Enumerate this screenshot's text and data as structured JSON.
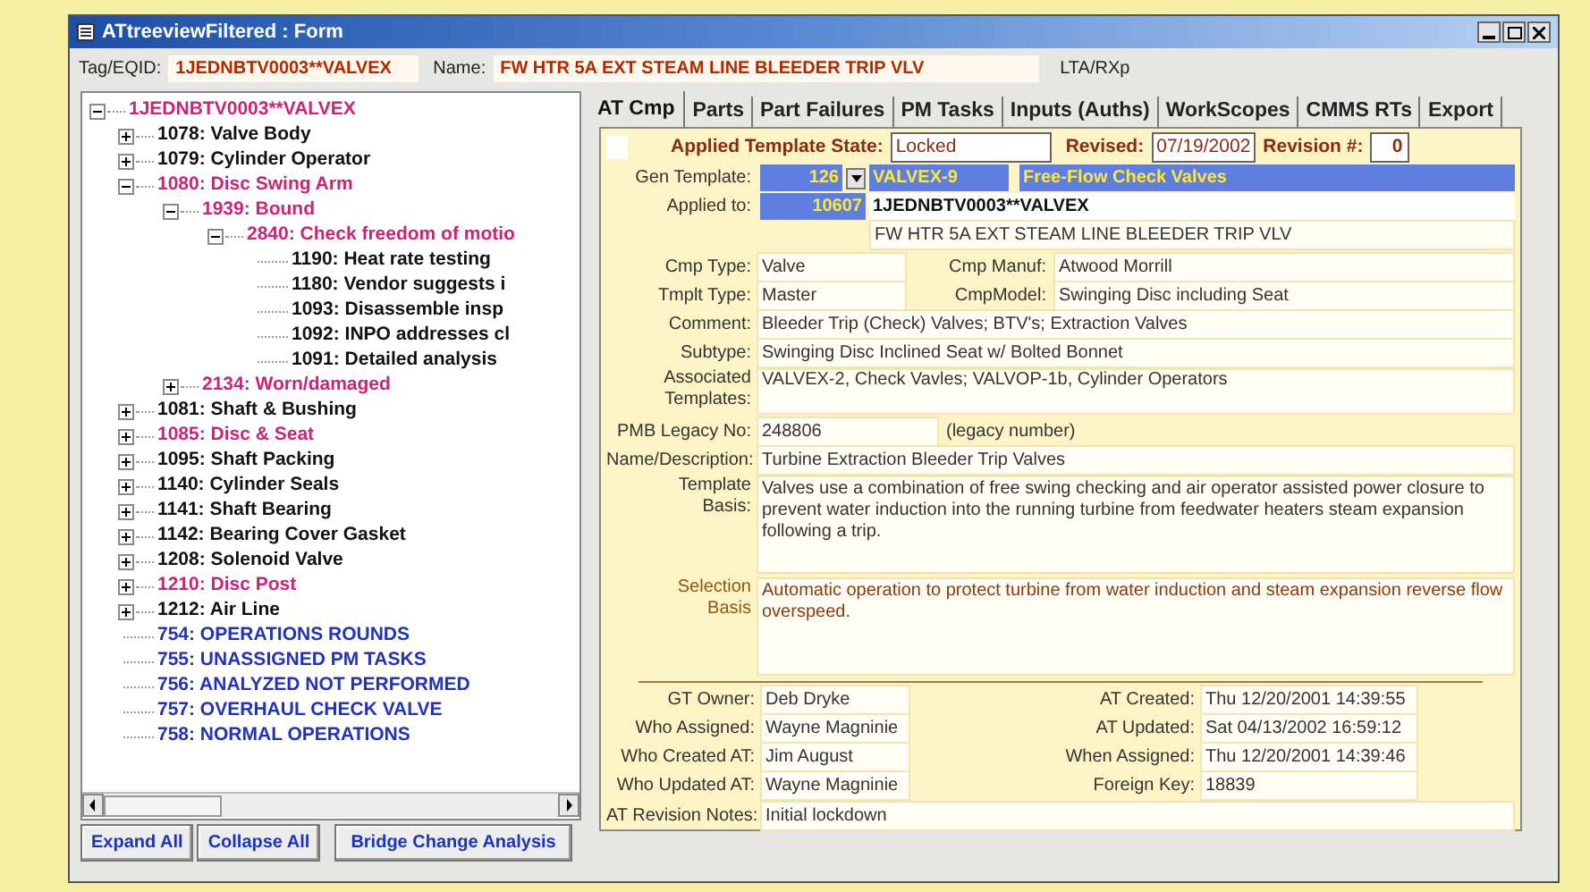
{
  "window": {
    "title": "ATtreeviewFiltered : Form"
  },
  "header": {
    "tag_label": "Tag/EQID:",
    "tag_value": "1JEDNBTV0003**VALVEX",
    "name_label": "Name:",
    "name_value": "FW HTR 5A EXT STEAM LINE BLEEDER TRIP VLV",
    "extra": "LTA/RXp"
  },
  "tree": {
    "label": "1JEDNBTV0003**VALVEX",
    "color": "#cc2277",
    "kind": "branch",
    "expanded": true,
    "children": [
      {
        "label": "1078: Valve Body",
        "color": "#111111",
        "kind": "branch",
        "expanded": false
      },
      {
        "label": "1079: Cylinder Operator",
        "color": "#111111",
        "kind": "branch",
        "expanded": false
      },
      {
        "label": "1080: Disc Swing Arm",
        "color": "#cc2277",
        "kind": "branch",
        "expanded": true,
        "children": [
          {
            "label": "1939: Bound",
            "color": "#cc2277",
            "kind": "branch",
            "expanded": true,
            "children": [
              {
                "label": "2840: Check freedom of motio",
                "color": "#cc2277",
                "kind": "branch",
                "expanded": true,
                "children": [
                  {
                    "label": "1190: Heat rate testing",
                    "color": "#111111",
                    "kind": "leaf"
                  },
                  {
                    "label": "1180: Vendor suggests i",
                    "color": "#111111",
                    "kind": "leaf"
                  },
                  {
                    "label": "1093: Disassemble insp",
                    "color": "#111111",
                    "kind": "leaf"
                  },
                  {
                    "label": "1092: INPO addresses cl",
                    "color": "#111111",
                    "kind": "leaf"
                  },
                  {
                    "label": "1091: Detailed analysis",
                    "color": "#111111",
                    "kind": "leaf"
                  }
                ]
              }
            ]
          },
          {
            "label": "2134: Worn/damaged",
            "color": "#cc2277",
            "kind": "branch",
            "expanded": false
          }
        ]
      },
      {
        "label": "1081: Shaft & Bushing",
        "color": "#111111",
        "kind": "branch",
        "expanded": false
      },
      {
        "label": "1085: Disc & Seat",
        "color": "#cc2277",
        "kind": "branch",
        "expanded": false
      },
      {
        "label": "1095: Shaft Packing",
        "color": "#111111",
        "kind": "branch",
        "expanded": false
      },
      {
        "label": "1140: Cylinder Seals",
        "color": "#111111",
        "kind": "branch",
        "expanded": false
      },
      {
        "label": "1141: Shaft Bearing",
        "color": "#111111",
        "kind": "branch",
        "expanded": false
      },
      {
        "label": "1142: Bearing Cover Gasket",
        "color": "#111111",
        "kind": "branch",
        "expanded": false
      },
      {
        "label": "1208: Solenoid Valve",
        "color": "#111111",
        "kind": "branch",
        "expanded": false
      },
      {
        "label": "1210: Disc Post",
        "color": "#cc2277",
        "kind": "branch",
        "expanded": false
      },
      {
        "label": "1212: Air Line",
        "color": "#111111",
        "kind": "branch",
        "expanded": false
      },
      {
        "label": "754: OPERATIONS ROUNDS",
        "color": "#2233bb",
        "kind": "leaf"
      },
      {
        "label": "755: UNASSIGNED PM TASKS",
        "color": "#2233bb",
        "kind": "leaf"
      },
      {
        "label": "756: ANALYZED NOT PERFORMED",
        "color": "#2233bb",
        "kind": "leaf"
      },
      {
        "label": "757: OVERHAUL CHECK VALVE",
        "color": "#2233bb",
        "kind": "leaf"
      },
      {
        "label": "758: NORMAL OPERATIONS",
        "color": "#2233bb",
        "kind": "leaf"
      }
    ]
  },
  "buttons": [
    "Expand All",
    "Collapse All",
    "Bridge Change Analysis"
  ],
  "tabs": [
    {
      "label": "AT Cmp",
      "selected": true
    },
    {
      "label": "Parts",
      "selected": false
    },
    {
      "label": "Part Failures",
      "selected": false
    },
    {
      "label": "PM Tasks",
      "selected": false
    },
    {
      "label": "Inputs (Auths)",
      "selected": false
    },
    {
      "label": "WorkScopes",
      "selected": false
    },
    {
      "label": "CMMS RTs",
      "selected": false
    },
    {
      "label": "Export",
      "selected": false
    }
  ],
  "form": {
    "state_label": "Applied Template State:",
    "state_value": "Locked",
    "revised_label": "Revised:",
    "revised_value": "07/19/2002",
    "revision_label": "Revision #:",
    "revision_value": "0",
    "gen_template": {
      "label": "Gen Template:",
      "number": "126",
      "code": "VALVEX-9",
      "description": "Free-Flow Check Valves"
    },
    "applied_to": {
      "label": "Applied to:",
      "number": "10607",
      "tag": "1JEDNBTV0003**VALVEX",
      "name": "FW HTR 5A EXT STEAM LINE BLEEDER TRIP VLV"
    },
    "rows": [
      {
        "kind": "pair",
        "fields": [
          {
            "label": "Cmp Type:",
            "value": "Valve"
          },
          {
            "label": "Cmp Manuf:",
            "value": "Atwood Morrill"
          }
        ]
      },
      {
        "kind": "pair",
        "fields": [
          {
            "label": "Tmplt Type:",
            "value": "Master"
          },
          {
            "label": "CmpModel:",
            "value": "Swinging Disc including Seat"
          }
        ]
      },
      {
        "kind": "full",
        "fields": [
          {
            "label": "Comment:",
            "value": "Bleeder Trip (Check) Valves; BTV's; Extraction Valves"
          }
        ]
      },
      {
        "kind": "full",
        "fields": [
          {
            "label": "Subtype:",
            "value": "Swinging Disc Inclined Seat w/ Bolted Bonnet"
          }
        ]
      },
      {
        "kind": "tall",
        "fields": [
          {
            "label": "Associated Templates:",
            "value": "VALVEX-2, Check Vavles; VALVOP-1b, Cylinder Operators"
          }
        ]
      },
      {
        "kind": "legacy",
        "fields": [
          {
            "label": "PMB Legacy No:",
            "value": "248806",
            "note": "(legacy number)"
          }
        ]
      },
      {
        "kind": "full",
        "fields": [
          {
            "label": "Name/Description:",
            "value": "Turbine Extraction Bleeder Trip Valves"
          }
        ]
      },
      {
        "kind": "memo",
        "fields": [
          {
            "label": "Template Basis:",
            "value": "Valves use a combination of free swing checking and air operator assisted power closure to prevent water induction into the running turbine from feedwater heaters steam expansion following a trip."
          }
        ]
      },
      {
        "kind": "memo_selection",
        "fields": [
          {
            "label": "Selection Basis",
            "value": "Automatic operation to protect turbine from water induction and steam expansion reverse flow overspeed."
          }
        ]
      }
    ],
    "audit": [
      [
        {
          "label": "GT Owner:",
          "value": "Deb Dryke"
        },
        {
          "label": "AT Created:",
          "value": "Thu 12/20/2001 14:39:55"
        }
      ],
      [
        {
          "label": "Who Assigned:",
          "value": "Wayne Magninie"
        },
        {
          "label": "AT Updated:",
          "value": "Sat 04/13/2002 16:59:12"
        }
      ],
      [
        {
          "label": "Who Created AT:",
          "value": "Jim August"
        },
        {
          "label": "When Assigned:",
          "value": "Thu 12/20/2001 14:39:46"
        }
      ],
      [
        {
          "label": "Who Updated AT:",
          "value": "Wayne Magninie"
        },
        {
          "label": "Foreign Key:",
          "value": "18839"
        }
      ]
    ],
    "notes": {
      "label": "AT Revision Notes:",
      "value": "Initial lockdown"
    }
  }
}
